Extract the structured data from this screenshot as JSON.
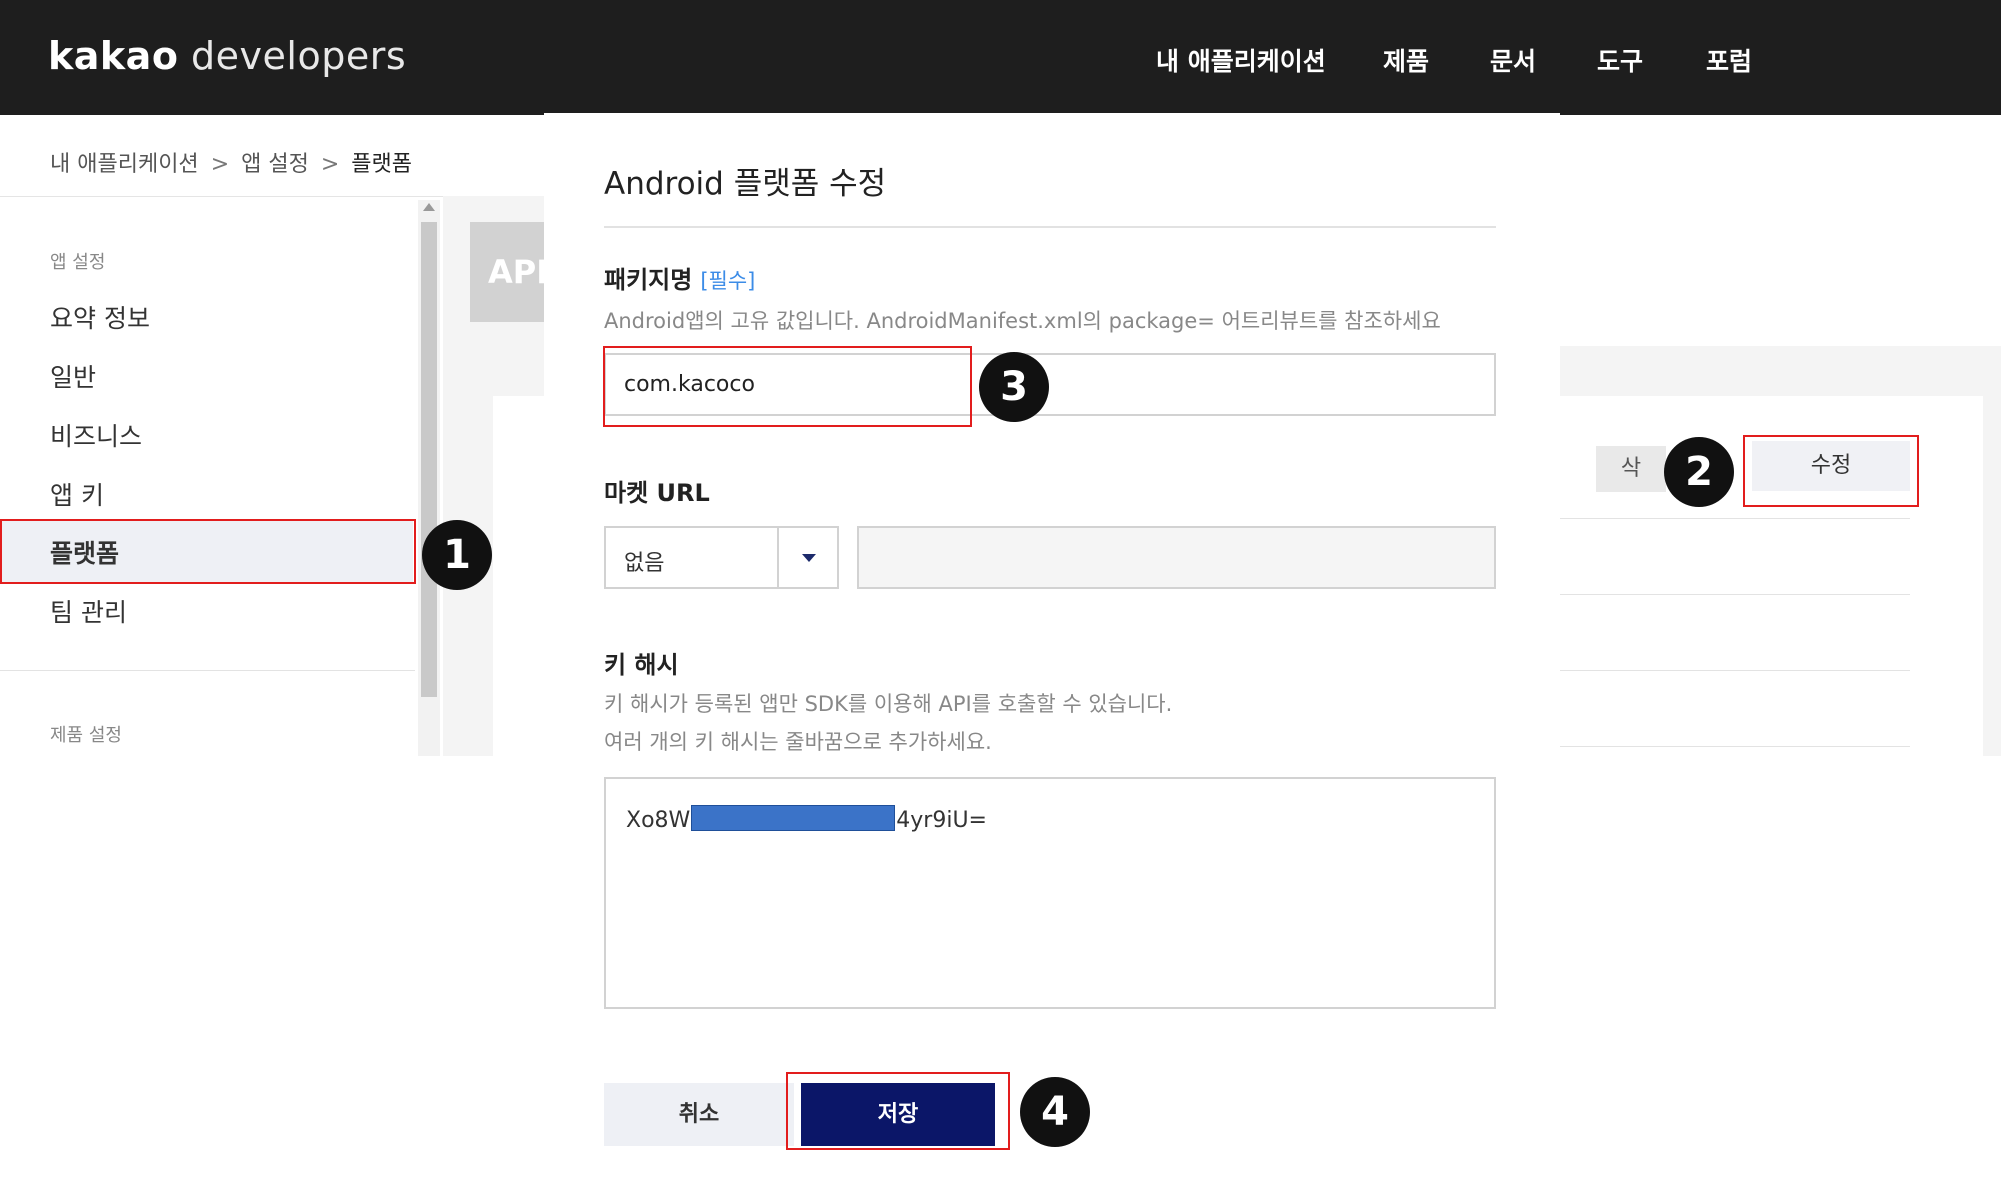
{
  "header": {
    "logo_bold": "kakao",
    "logo_light": "developers",
    "nav": [
      "내 애플리케이션",
      "제품",
      "문서",
      "도구",
      "포럼"
    ]
  },
  "breadcrumb": [
    "내 애플리케이션",
    "앱 설정",
    "플랫폼"
  ],
  "breadcrumb_sep": ">",
  "sidebar": {
    "section_app": "앱 설정",
    "items": [
      "요약 정보",
      "일반",
      "비즈니스",
      "앱 키",
      "플랫폼",
      "팀 관리"
    ],
    "section_product": "제품 설정"
  },
  "background": {
    "app_chip": "APP",
    "grey_button": "삭",
    "edit_button": "수정"
  },
  "modal": {
    "title": "Android 플랫폼 수정",
    "package": {
      "label": "패키지명",
      "required": "[필수]",
      "help": "Android앱의 고유 값입니다. AndroidManifest.xml의 package= 어트리뷰트를 참조하세요",
      "value": "com.kacoco"
    },
    "market": {
      "label": "마켓 URL",
      "select_value": "없음",
      "url_value": ""
    },
    "keyhash": {
      "label": "키 해시",
      "help1": "키 해시가 등록된 앱만 SDK를 이용해 API를 호출할 수 있습니다.",
      "help2": "여러 개의 키 해시는 줄바꿈으로 추가하세요.",
      "value_prefix": "Xo8W",
      "value_suffix": "4yr9iU="
    },
    "cancel_label": "취소",
    "save_label": "저장"
  },
  "annotations": {
    "steps": [
      "1",
      "2",
      "3",
      "4"
    ],
    "box_color": "#e21d1d"
  },
  "colors": {
    "header_bg": "#1e1e1e",
    "save_button": "#0b1668",
    "required_link": "#3c8ce7"
  }
}
